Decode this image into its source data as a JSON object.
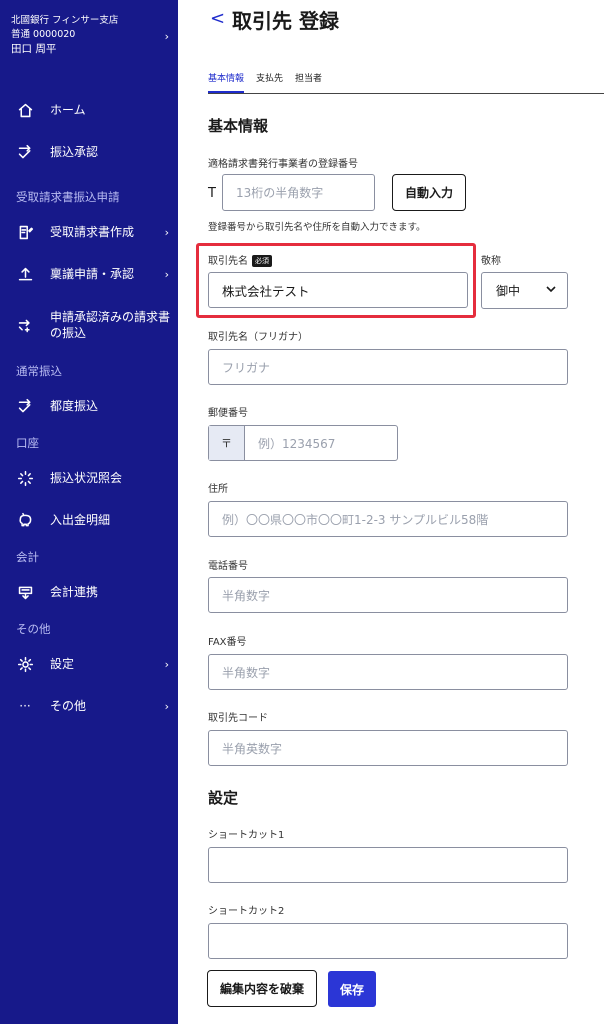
{
  "account": {
    "branch": "北國銀行 フィンサー支店",
    "number": "普通 0000020",
    "user": "田口 周平"
  },
  "sidebar": {
    "items": [
      {
        "label": "ホーム"
      },
      {
        "label": "振込承認"
      },
      {
        "label": "受取請求書作成"
      },
      {
        "label": "稟議申請・承認"
      },
      {
        "label": "申請承認済みの請求書の振込"
      },
      {
        "label": "都度振込"
      },
      {
        "label": "振込状況照会"
      },
      {
        "label": "入出金明細"
      },
      {
        "label": "会計連携"
      },
      {
        "label": "設定"
      },
      {
        "label": "その他"
      }
    ],
    "sections": [
      "受取請求書振込申請",
      "通常振込",
      "口座",
      "会計",
      "その他"
    ]
  },
  "header": {
    "back": "<",
    "title": "取引先 登録"
  },
  "tabs": [
    {
      "label": "基本情報"
    },
    {
      "label": "支払先"
    },
    {
      "label": "担当者"
    }
  ],
  "basic": {
    "heading": "基本情報",
    "reg_label": "適格請求書発行事業者の登録番号",
    "reg_prefix": "T",
    "reg_placeholder": "13桁の半角数字",
    "auto_btn": "自動入力",
    "help": "登録番号から取引先名や住所を自動入力できます。",
    "name_label": "取引先名",
    "required": "必須",
    "name_value": "株式会社テスト",
    "honorific_label": "敬称",
    "honorific_value": "御中",
    "kana_label": "取引先名（フリガナ）",
    "kana_placeholder": "フリガナ",
    "zip_label": "郵便番号",
    "zip_prefix": "〒",
    "zip_placeholder": "例）1234567",
    "addr_label": "住所",
    "addr_placeholder": "例）〇〇県〇〇市〇〇町1-2-3 サンプルビル58階",
    "tel_label": "電話番号",
    "tel_placeholder": "半角数字",
    "fax_label": "FAX番号",
    "fax_placeholder": "半角数字",
    "code_label": "取引先コード",
    "code_placeholder": "半角英数字"
  },
  "settings": {
    "heading": "設定",
    "sc1_label": "ショートカット1",
    "sc2_label": "ショートカット2"
  },
  "footer": {
    "discard": "編集内容を破棄",
    "save": "保存"
  },
  "colors": {
    "sidebar": "#17198a",
    "accent": "#2b36d6",
    "highlight": "#e52d3d"
  }
}
